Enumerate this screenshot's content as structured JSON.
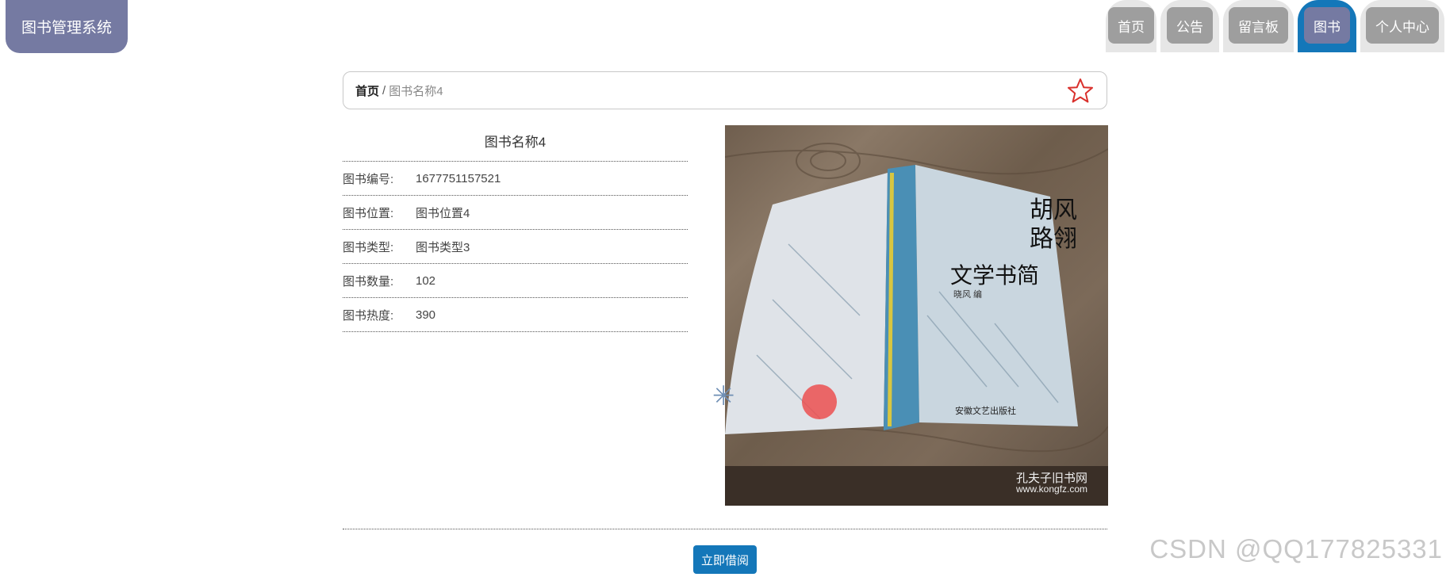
{
  "app": {
    "logo_text": "图书管理系统"
  },
  "nav": {
    "tabs": [
      {
        "label": "首页",
        "active": false
      },
      {
        "label": "公告",
        "active": false
      },
      {
        "label": "留言板",
        "active": false
      },
      {
        "label": "图书",
        "active": true
      },
      {
        "label": "个人中心",
        "active": false
      }
    ]
  },
  "breadcrumb": {
    "home": "首页",
    "separator": "/",
    "current": "图书名称4",
    "favorite_icon": "star-icon"
  },
  "book": {
    "title": "图书名称4",
    "fields": [
      {
        "label": "图书编号:",
        "value": "1677751157521"
      },
      {
        "label": "图书位置:",
        "value": "图书位置4"
      },
      {
        "label": "图书类型:",
        "value": "图书类型3"
      },
      {
        "label": "图书数量:",
        "value": "102"
      },
      {
        "label": "图书热度:",
        "value": "390"
      }
    ],
    "cover": {
      "title_lines": [
        "胡风",
        "路翎"
      ],
      "subtitle": "文学书简",
      "author": "晓风 编",
      "publisher": "安徽文艺出版社",
      "watermark_cn": "孔夫子旧书网",
      "watermark_url": "www.kongfz.com"
    }
  },
  "actions": {
    "borrow_label": "立即借阅"
  },
  "watermark": {
    "text": "CSDN @QQ177825331"
  },
  "colors": {
    "primary": "#1477b9",
    "logo_bg": "#757aa2",
    "tab_bg": "#9e9e9e",
    "star": "#d9302c"
  }
}
